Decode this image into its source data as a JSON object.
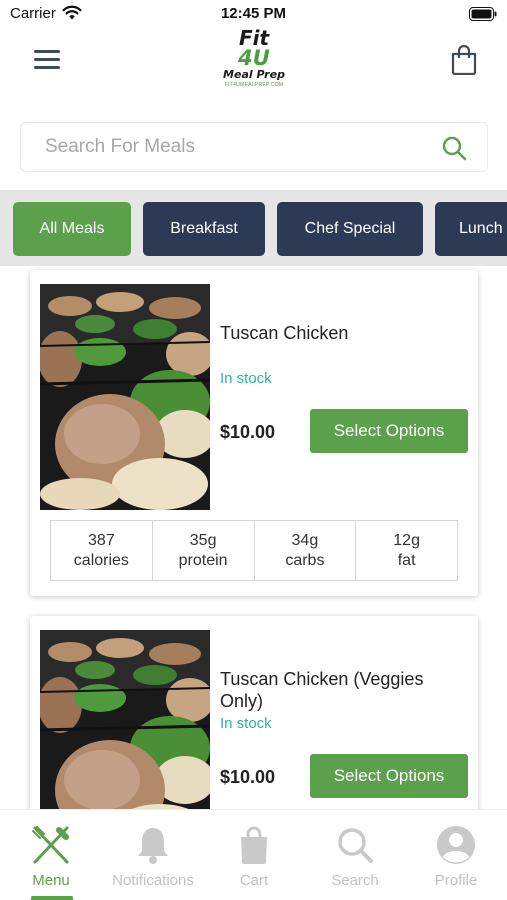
{
  "status_bar": {
    "carrier": "Carrier",
    "time": "12:45 PM"
  },
  "header": {
    "logo_line1": "Fit",
    "logo_line2": "4U",
    "logo_line3": "Meal Prep",
    "logo_tagline": "FIT4UMEALPREP.COM",
    "menu_icon": "hamburger-icon",
    "cart_icon": "shopping-bag-icon"
  },
  "search": {
    "placeholder": "Search For Meals",
    "icon": "search-icon"
  },
  "categories": [
    {
      "label": "All Meals",
      "active": true
    },
    {
      "label": "Breakfast",
      "active": false
    },
    {
      "label": "Chef Special",
      "active": false
    },
    {
      "label": "Lunch",
      "active": false
    }
  ],
  "meals": [
    {
      "title": "Tuscan Chicken",
      "stock": "In stock",
      "price": "$10.00",
      "button": "Select Options",
      "macros": [
        {
          "value": "387",
          "unit": "calories"
        },
        {
          "value": "35g",
          "unit": "protein"
        },
        {
          "value": "34g",
          "unit": "carbs"
        },
        {
          "value": "12g",
          "unit": "fat"
        }
      ]
    },
    {
      "title": "Tuscan Chicken (Veggies Only)",
      "stock": "In stock",
      "price": "$10.00",
      "button": "Select Options"
    }
  ],
  "tabs": [
    {
      "label": "Menu",
      "icon": "fork-knife-icon",
      "active": true
    },
    {
      "label": "Notifications",
      "icon": "bell-icon",
      "active": false
    },
    {
      "label": "Cart",
      "icon": "bag-icon",
      "active": false
    },
    {
      "label": "Search",
      "icon": "search-icon",
      "active": false
    },
    {
      "label": "Profile",
      "icon": "profile-icon",
      "active": false
    }
  ],
  "colors": {
    "accent_green": "#5ba04a",
    "navy": "#2c3a56",
    "stock_teal": "#2bb5a0",
    "inactive_tab": "#c2c2c2"
  }
}
